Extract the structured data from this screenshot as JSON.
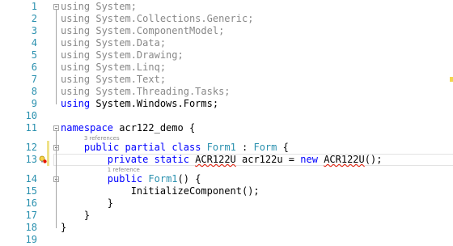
{
  "editor": {
    "lines": [
      {
        "number": "1",
        "tokens": [
          {
            "t": "using",
            "c": "kw"
          },
          {
            "t": " System;",
            "c": ""
          }
        ],
        "dim": true
      },
      {
        "number": "2",
        "tokens": [
          {
            "t": "using",
            "c": "kw"
          },
          {
            "t": " System.Collections.Generic;",
            "c": ""
          }
        ],
        "dim": true
      },
      {
        "number": "3",
        "tokens": [
          {
            "t": "using",
            "c": "kw"
          },
          {
            "t": " System.ComponentModel;",
            "c": ""
          }
        ],
        "dim": true
      },
      {
        "number": "4",
        "tokens": [
          {
            "t": "using",
            "c": "kw"
          },
          {
            "t": " System.Data;",
            "c": ""
          }
        ],
        "dim": true
      },
      {
        "number": "5",
        "tokens": [
          {
            "t": "using",
            "c": "kw"
          },
          {
            "t": " System.Drawing;",
            "c": ""
          }
        ],
        "dim": true
      },
      {
        "number": "6",
        "tokens": [
          {
            "t": "using",
            "c": "kw"
          },
          {
            "t": " System.Linq;",
            "c": ""
          }
        ],
        "dim": true
      },
      {
        "number": "7",
        "tokens": [
          {
            "t": "using",
            "c": "kw"
          },
          {
            "t": " System.Text;",
            "c": ""
          }
        ],
        "dim": true
      },
      {
        "number": "8",
        "tokens": [
          {
            "t": "using",
            "c": "kw"
          },
          {
            "t": " System.Threading.Tasks;",
            "c": ""
          }
        ],
        "dim": true
      },
      {
        "number": "9",
        "tokens": [
          {
            "t": "using",
            "c": "kw"
          },
          {
            "t": " System.Windows.Forms;",
            "c": ""
          }
        ],
        "dim": false
      },
      {
        "number": "10",
        "tokens": [],
        "dim": false
      },
      {
        "number": "11",
        "tokens": [
          {
            "t": "namespace",
            "c": "kw"
          },
          {
            "t": " acr122_demo {",
            "c": ""
          }
        ],
        "dim": false
      },
      {
        "number": "12",
        "tokens": [
          {
            "t": "    ",
            "c": ""
          },
          {
            "t": "public",
            "c": "kw"
          },
          {
            "t": " ",
            "c": ""
          },
          {
            "t": "partial",
            "c": "kw"
          },
          {
            "t": " ",
            "c": ""
          },
          {
            "t": "class",
            "c": "kw"
          },
          {
            "t": " ",
            "c": ""
          },
          {
            "t": "Form1",
            "c": "ty"
          },
          {
            "t": " : ",
            "c": ""
          },
          {
            "t": "Form",
            "c": "ty"
          },
          {
            "t": " {",
            "c": ""
          }
        ],
        "dim": false
      },
      {
        "number": "13",
        "tokens": [
          {
            "t": "        ",
            "c": ""
          },
          {
            "t": "private",
            "c": "kw"
          },
          {
            "t": " ",
            "c": ""
          },
          {
            "t": "static",
            "c": "kw"
          },
          {
            "t": " ",
            "c": ""
          },
          {
            "t": "ACR122U",
            "c": "err"
          },
          {
            "t": " acr122u = ",
            "c": ""
          },
          {
            "t": "new",
            "c": "kw"
          },
          {
            "t": " ",
            "c": ""
          },
          {
            "t": "ACR122U",
            "c": "err"
          },
          {
            "t": "();",
            "c": ""
          }
        ],
        "dim": false
      },
      {
        "number": "14",
        "tokens": [
          {
            "t": "        ",
            "c": ""
          },
          {
            "t": "public",
            "c": "kw"
          },
          {
            "t": " ",
            "c": ""
          },
          {
            "t": "Form1",
            "c": "ty"
          },
          {
            "t": "() {",
            "c": ""
          }
        ],
        "dim": false
      },
      {
        "number": "15",
        "tokens": [
          {
            "t": "            InitializeComponent();",
            "c": ""
          }
        ],
        "dim": false
      },
      {
        "number": "16",
        "tokens": [
          {
            "t": "        }",
            "c": ""
          }
        ],
        "dim": false
      },
      {
        "number": "17",
        "tokens": [
          {
            "t": "    }",
            "c": ""
          }
        ],
        "dim": false
      },
      {
        "number": "18",
        "tokens": [
          {
            "t": "}",
            "c": ""
          }
        ],
        "dim": false
      },
      {
        "number": "19",
        "tokens": [],
        "dim": false
      }
    ],
    "codelens": [
      {
        "text": "3 references",
        "before_line": 12
      },
      {
        "text": "1 reference",
        "before_line": 14
      }
    ],
    "colors": {
      "keyword": "#0000ff",
      "type": "#2b91af",
      "line_number": "#2b91af",
      "error_squiggle": "#e51400",
      "change_bar": "#efe28a"
    },
    "icons": {
      "fold": "collapse-minus-icon",
      "quick_action": "lightbulb-error-icon"
    }
  }
}
